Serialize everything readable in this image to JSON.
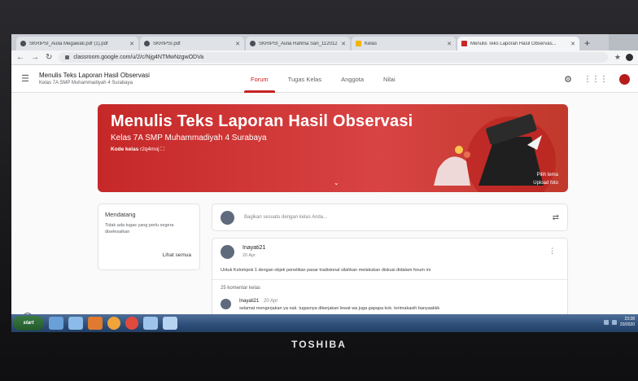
{
  "browser": {
    "tabs": [
      {
        "title": "SKRIPSI_Aulia Megawati.pdf (1).pdf",
        "icon": "document-icon",
        "active": false
      },
      {
        "title": "SKRIPSI.pdf",
        "icon": "document-icon",
        "active": false
      },
      {
        "title": "SKRIPSI_Aulia Rahma Sari_1120121...",
        "icon": "document-icon",
        "active": false
      },
      {
        "title": "Kelas",
        "icon": "classroom-icon",
        "active": false
      },
      {
        "title": "Menulis Teks Laporan Hasil Observas...",
        "icon": "classroom-icon",
        "active": true
      }
    ],
    "new_tab_label": "+",
    "url": "classroom.google.com/u/2/c/Njg4NTMwNzgwODVa"
  },
  "classroom": {
    "class_name": "Menulis Teks Laporan Hasil Observasi",
    "class_section": "Kelas 7A SMP Muhammadiyah 4 Surabaya",
    "tabs": [
      "Forum",
      "Tugas Kelas",
      "Anggota",
      "Nilai"
    ],
    "active_tab": "Forum"
  },
  "banner": {
    "title": "Menulis Teks Laporan Hasil Observasi",
    "subtitle": "Kelas 7A SMP Muhammadiyah 4 Surabaya",
    "code_label": "Kode kelas",
    "code_value": "r2q4moj",
    "upload_line1": "Pilih tema",
    "upload_line2": "Upload foto",
    "color": "#c62828"
  },
  "upcoming": {
    "heading": "Mendatang",
    "empty_text": "Tidak ada tugas yang perlu segera diselesaikan",
    "link": "Lihat semua"
  },
  "stream": {
    "share_placeholder": "Bagikan sesuatu dengan kelas Anda...",
    "post": {
      "author": "Inayati21",
      "date": "20 Apr",
      "body": "Untuk Kelompok 1 dengan objek penelitian pasar tradisional silahkan melakukan diskusi didalam forum ini",
      "comment_count_label": "25 komentar kelas",
      "comment": {
        "author": "Inayati21",
        "date": "20 Apr",
        "text": "selamat mengerjakan ya nak. tugasnya dikerjakan lewat wa juga gapapa kok. terimakasih banyaakkk"
      }
    }
  },
  "taskbar": {
    "start_label": "start",
    "clock_time": "23:28",
    "clock_date": "20/2020"
  },
  "laptop_brand": "TOSHIBA"
}
